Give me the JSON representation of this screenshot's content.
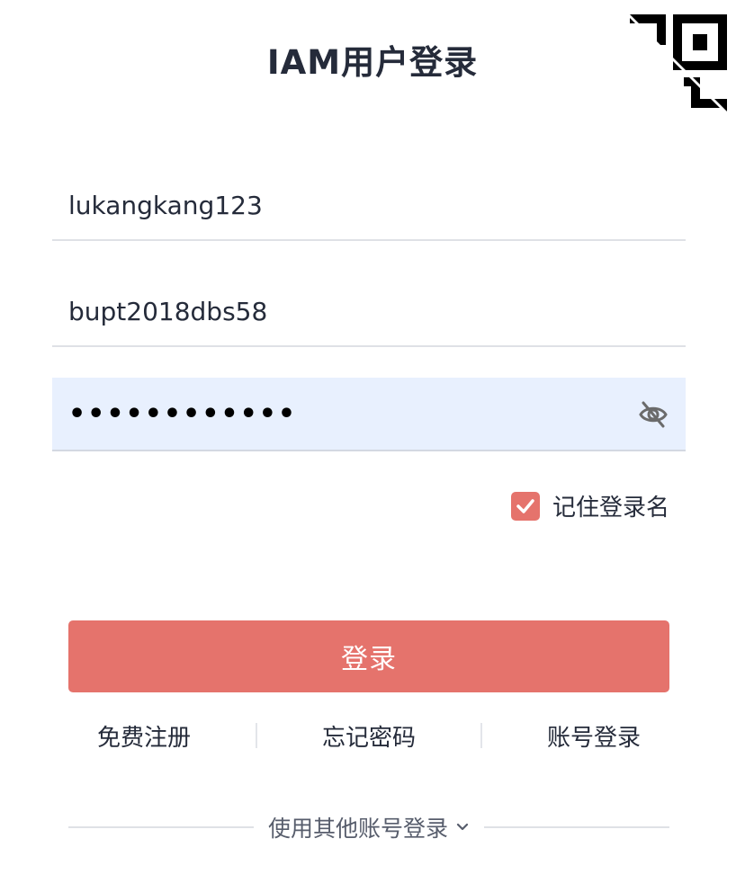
{
  "header": {
    "title": "IAM用户登录"
  },
  "corner": {
    "icon": "qr-code-corner-icon"
  },
  "form": {
    "account_value": "lukangkang123",
    "username_value": "bupt2018dbs58",
    "password_masked": "••••••••••••",
    "password_toggle_icon": "eye-slash-icon",
    "remember_label": "记住登录名",
    "remember_checked": true
  },
  "actions": {
    "login_label": "登录"
  },
  "links": {
    "register": "免费注册",
    "forgot_password": "忘记密码",
    "account_login": "账号登录"
  },
  "other_login": {
    "label": "使用其他账号登录",
    "icon": "chevron-down-icon"
  },
  "colors": {
    "accent": "#e5736c",
    "password_bg": "#e8f0fe",
    "text": "#252b3a",
    "muted": "#575d6c",
    "divider": "#dfe1e6"
  }
}
